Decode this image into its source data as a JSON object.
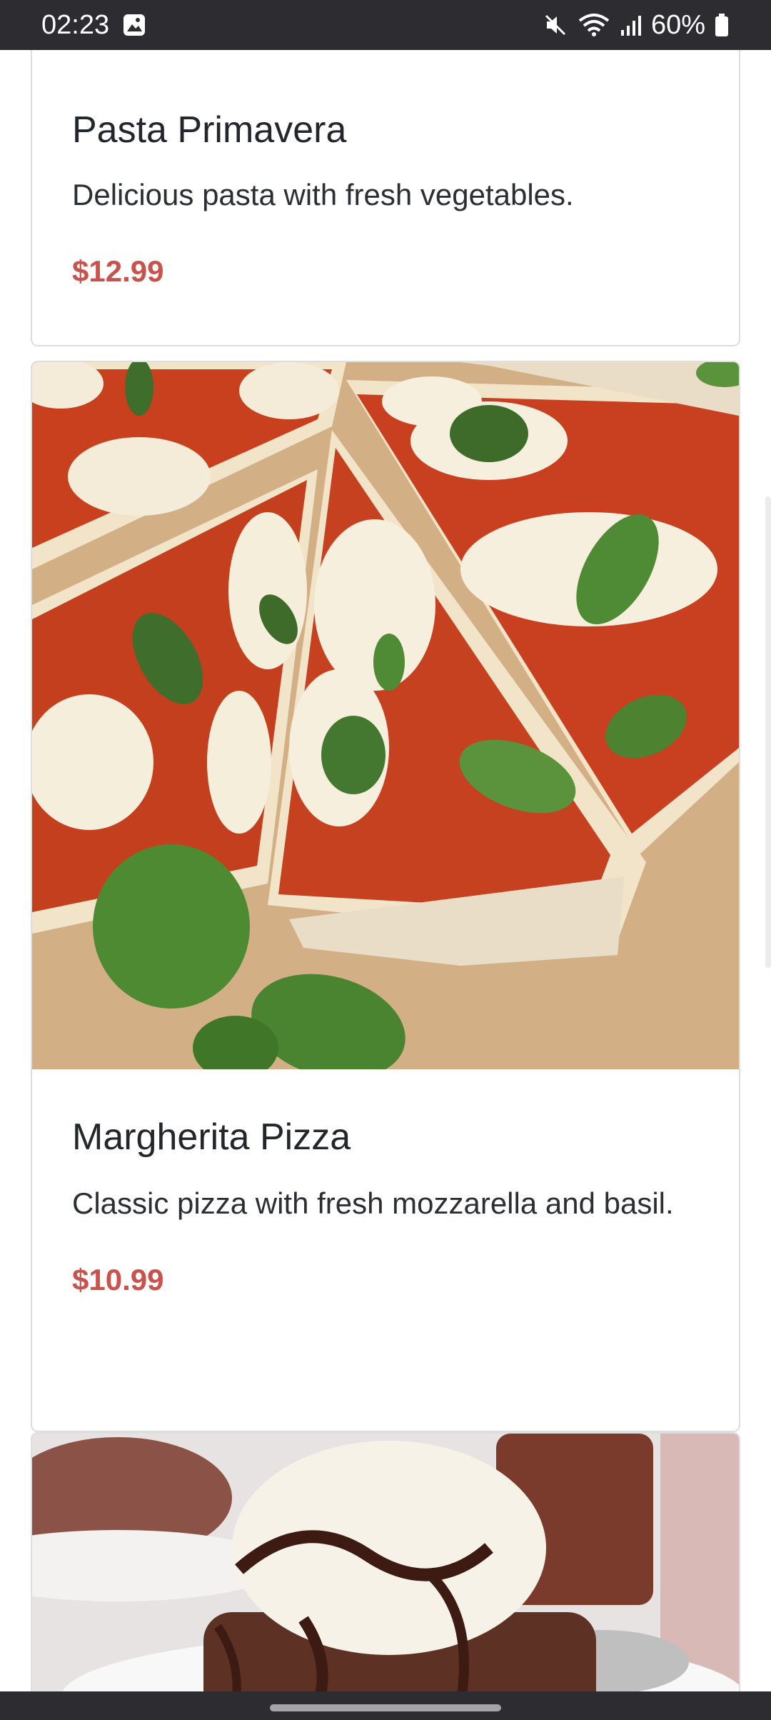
{
  "status_bar": {
    "time": "02:23",
    "battery_percent": "60%",
    "icons": [
      "gallery-icon",
      "mute-icon",
      "wifi-icon",
      "signal-icon",
      "battery-icon"
    ]
  },
  "menu_items": [
    {
      "title": "Pasta Primavera",
      "description": "Delicious pasta with fresh vegetables.",
      "price": "$12.99"
    },
    {
      "title": "Margherita Pizza",
      "description": "Classic pizza with fresh mozzarella and basil.",
      "price": "$10.99",
      "image": "pizza-photo"
    },
    {
      "image": "chocolate-lava-cake-photo"
    }
  ],
  "colors": {
    "price": "#c9524d",
    "status_bar": "#2c2c31",
    "card_border": "#dedede"
  }
}
